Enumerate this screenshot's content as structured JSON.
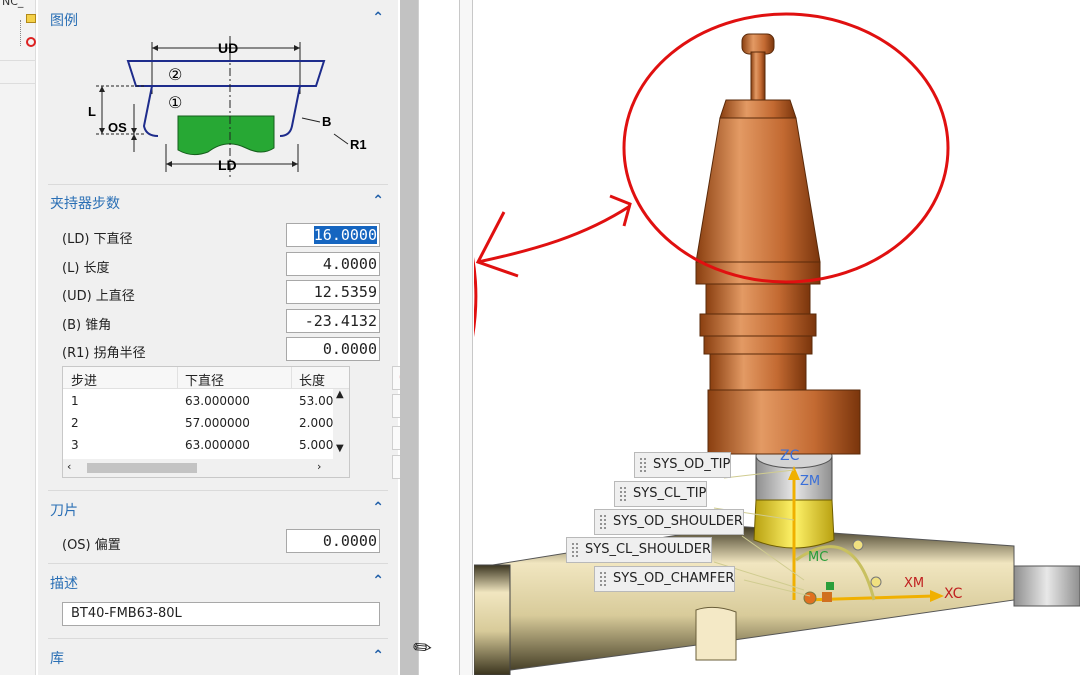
{
  "navigator": {
    "title": "NC_"
  },
  "legend": {
    "header": "图例",
    "labels": {
      "ud": "UD",
      "ld": "LD",
      "l": "L",
      "os": "OS",
      "b": "B",
      "r1": "R1",
      "n1": "①",
      "n2": "②"
    }
  },
  "holder_steps": {
    "header": "夹持器步数",
    "params": [
      {
        "label": "(LD) 下直径",
        "value": "16.0000"
      },
      {
        "label": "(L) 长度",
        "value": "4.0000"
      },
      {
        "label": "(UD) 上直径",
        "value": "12.5359"
      },
      {
        "label": "(B) 锥角",
        "value": "-23.4132"
      },
      {
        "label": "(R1) 拐角半径",
        "value": "0.0000"
      }
    ],
    "table": {
      "columns": [
        "步进",
        "下直径",
        "长度"
      ],
      "rows": [
        [
          "1",
          "63.000000",
          "53.00"
        ],
        [
          "2",
          "57.000000",
          "2.000"
        ],
        [
          "3",
          "63.000000",
          "5.000"
        ]
      ]
    }
  },
  "insert": {
    "header": "刀片",
    "offset_label": "(OS) 偏置",
    "offset_value": "0.0000"
  },
  "description": {
    "header": "描述",
    "value": "BT40-FMB63-80L"
  },
  "library": {
    "header": "库"
  },
  "viewport": {
    "tags": [
      "SYS_OD_TIP",
      "SYS_CL_TIP",
      "SYS_OD_SHOULDER",
      "SYS_CL_SHOULDER",
      "SYS_OD_CHAMFER"
    ],
    "axes": {
      "zc": "ZC",
      "zm": "ZM",
      "mc": "MC",
      "xm": "XM",
      "xc": "XC"
    }
  }
}
